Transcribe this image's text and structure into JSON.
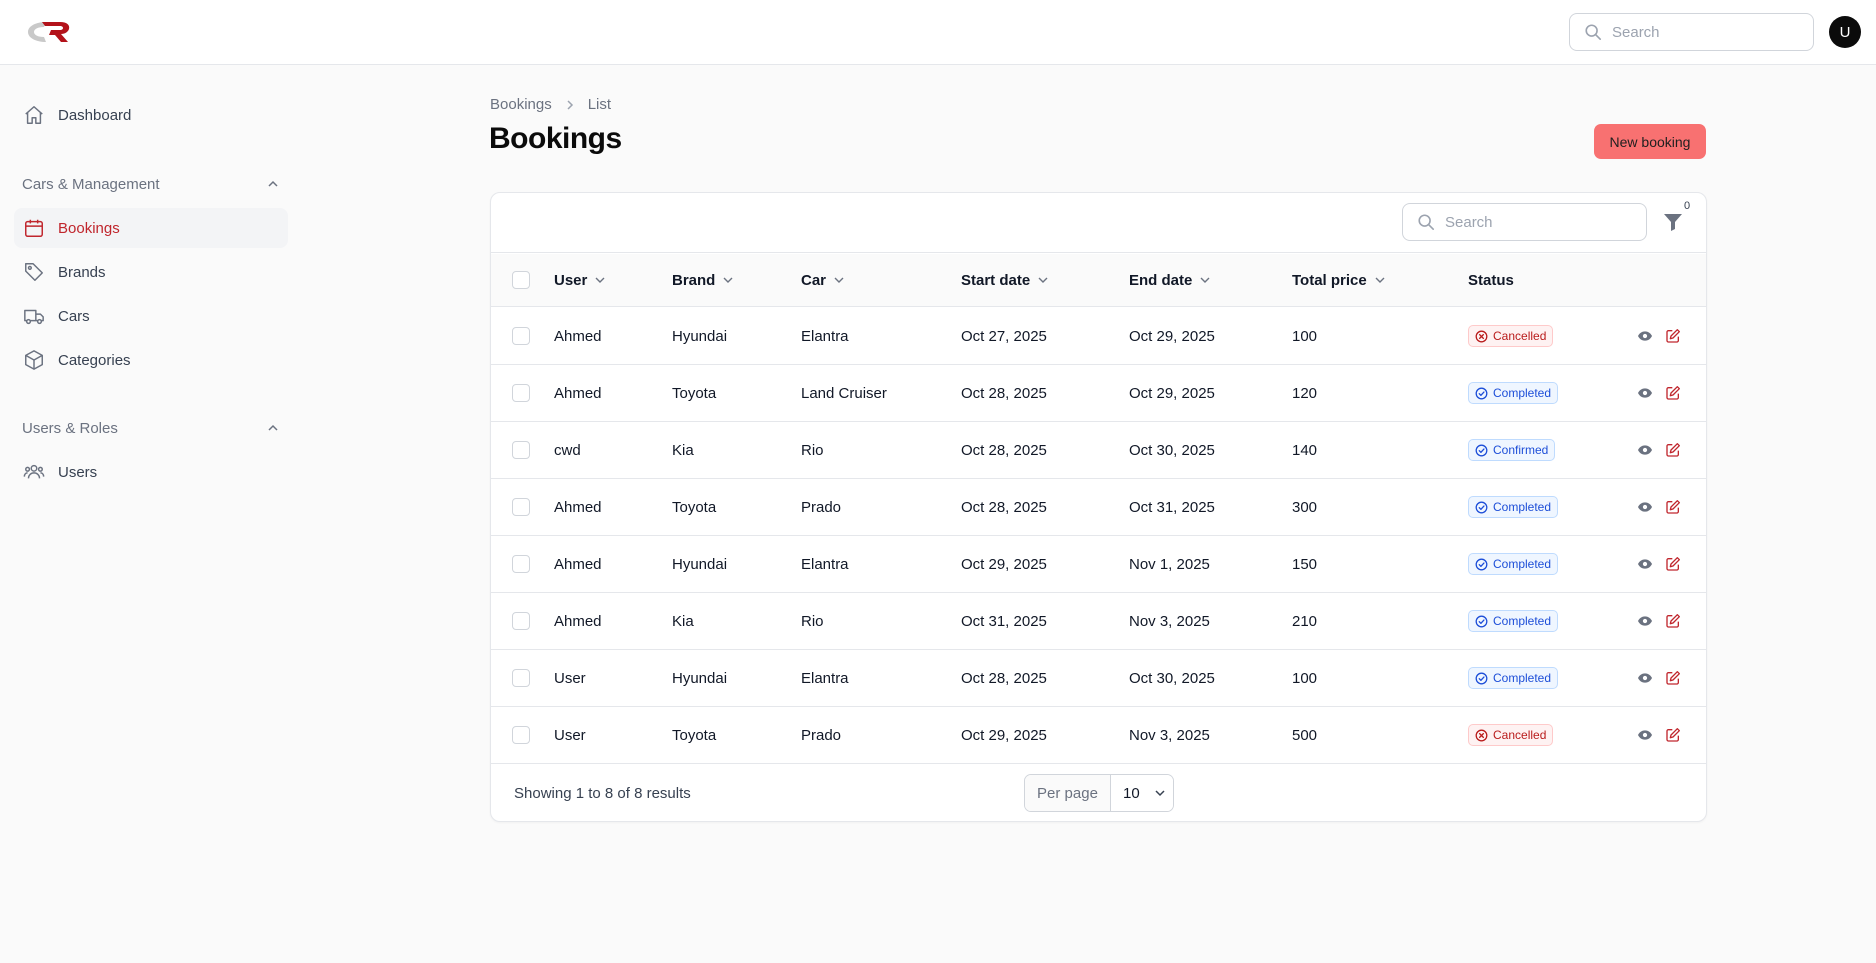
{
  "header": {
    "search_placeholder": "Search",
    "avatar_initial": "U"
  },
  "sidebar": {
    "dashboard": "Dashboard",
    "group_cars": "Cars & Management",
    "bookings": "Bookings",
    "brands": "Brands",
    "cars": "Cars",
    "categories": "Categories",
    "group_users": "Users & Roles",
    "users": "Users"
  },
  "breadcrumb": {
    "parent": "Bookings",
    "current": "List"
  },
  "page": {
    "title": "Bookings",
    "new_button": "New booking"
  },
  "table": {
    "search_placeholder": "Search",
    "filter_count": "0",
    "columns": {
      "user": "User",
      "brand": "Brand",
      "car": "Car",
      "start_date": "Start date",
      "end_date": "End date",
      "total_price": "Total price",
      "status": "Status"
    },
    "rows": [
      {
        "user": "Ahmed",
        "brand": "Hyundai",
        "car": "Elantra",
        "start": "Oct 27, 2025",
        "end": "Oct 29, 2025",
        "price": "100",
        "status": "Cancelled",
        "kind": "cancelled"
      },
      {
        "user": "Ahmed",
        "brand": "Toyota",
        "car": "Land Cruiser",
        "start": "Oct 28, 2025",
        "end": "Oct 29, 2025",
        "price": "120",
        "status": "Completed",
        "kind": "completed"
      },
      {
        "user": "cwd",
        "brand": "Kia",
        "car": "Rio",
        "start": "Oct 28, 2025",
        "end": "Oct 30, 2025",
        "price": "140",
        "status": "Confirmed",
        "kind": "completed"
      },
      {
        "user": "Ahmed",
        "brand": "Toyota",
        "car": "Prado",
        "start": "Oct 28, 2025",
        "end": "Oct 31, 2025",
        "price": "300",
        "status": "Completed",
        "kind": "completed"
      },
      {
        "user": "Ahmed",
        "brand": "Hyundai",
        "car": "Elantra",
        "start": "Oct 29, 2025",
        "end": "Nov 1, 2025",
        "price": "150",
        "status": "Completed",
        "kind": "completed"
      },
      {
        "user": "Ahmed",
        "brand": "Kia",
        "car": "Rio",
        "start": "Oct 31, 2025",
        "end": "Nov 3, 2025",
        "price": "210",
        "status": "Completed",
        "kind": "completed"
      },
      {
        "user": "User",
        "brand": "Hyundai",
        "car": "Elantra",
        "start": "Oct 28, 2025",
        "end": "Oct 30, 2025",
        "price": "100",
        "status": "Completed",
        "kind": "completed"
      },
      {
        "user": "User",
        "brand": "Toyota",
        "car": "Prado",
        "start": "Oct 29, 2025",
        "end": "Nov 3, 2025",
        "price": "500",
        "status": "Cancelled",
        "kind": "cancelled"
      }
    ],
    "showing": "Showing 1 to 8 of 8 results",
    "per_page_label": "Per page",
    "per_page_value": "10"
  },
  "colors": {
    "brand": "#c0262d",
    "new_button": "#f87171",
    "cancelled": "#b91c1c",
    "completed": "#1d4ed8"
  },
  "icons": {
    "logo": "cr-logo",
    "search": "search-icon",
    "dashboard": "home-icon",
    "bookings": "calendar-icon",
    "brands": "tag-icon",
    "cars": "truck-icon",
    "categories": "cube-icon",
    "users": "users-icon",
    "filter": "funnel-icon",
    "view": "eye-icon",
    "edit": "edit-icon",
    "cancelled": "x-circle-icon",
    "completed": "check-circle-icon"
  }
}
